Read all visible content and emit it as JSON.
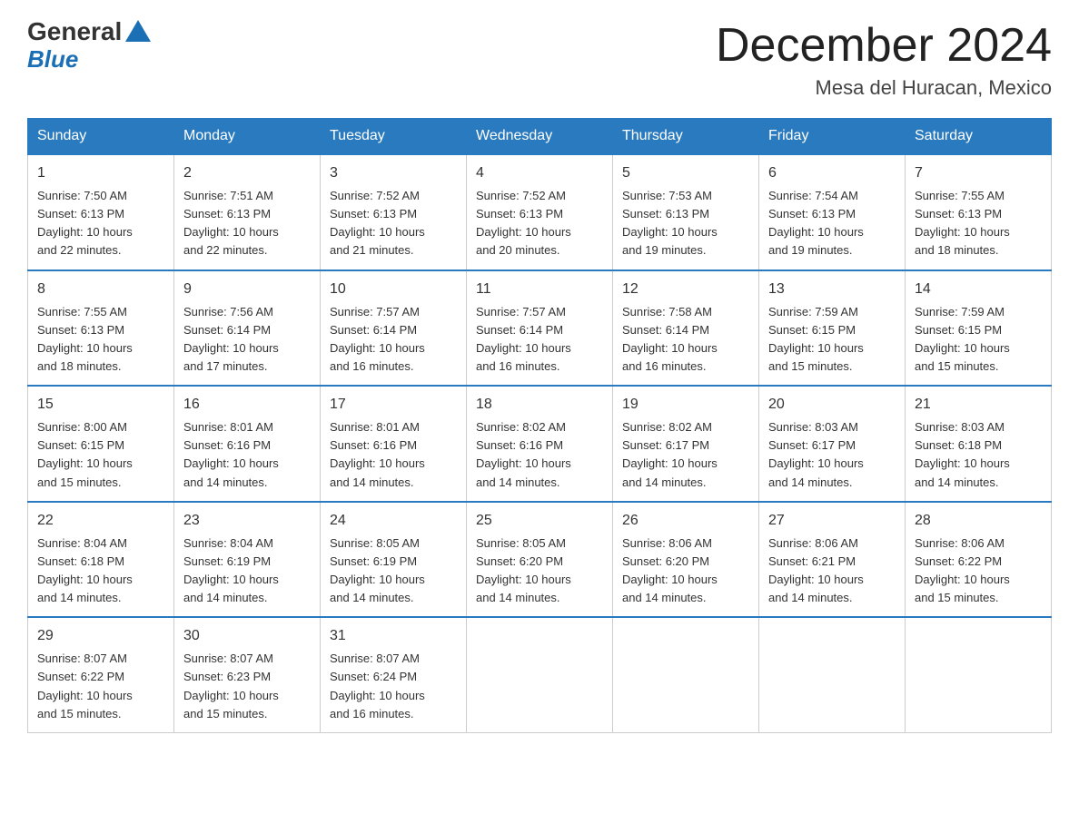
{
  "header": {
    "logo_general": "General",
    "logo_blue": "Blue",
    "title": "December 2024",
    "subtitle": "Mesa del Huracan, Mexico"
  },
  "days_of_week": [
    "Sunday",
    "Monday",
    "Tuesday",
    "Wednesday",
    "Thursday",
    "Friday",
    "Saturday"
  ],
  "weeks": [
    [
      {
        "day": "1",
        "sunrise": "7:50 AM",
        "sunset": "6:13 PM",
        "daylight": "10 hours and 22 minutes."
      },
      {
        "day": "2",
        "sunrise": "7:51 AM",
        "sunset": "6:13 PM",
        "daylight": "10 hours and 22 minutes."
      },
      {
        "day": "3",
        "sunrise": "7:52 AM",
        "sunset": "6:13 PM",
        "daylight": "10 hours and 21 minutes."
      },
      {
        "day": "4",
        "sunrise": "7:52 AM",
        "sunset": "6:13 PM",
        "daylight": "10 hours and 20 minutes."
      },
      {
        "day": "5",
        "sunrise": "7:53 AM",
        "sunset": "6:13 PM",
        "daylight": "10 hours and 19 minutes."
      },
      {
        "day": "6",
        "sunrise": "7:54 AM",
        "sunset": "6:13 PM",
        "daylight": "10 hours and 19 minutes."
      },
      {
        "day": "7",
        "sunrise": "7:55 AM",
        "sunset": "6:13 PM",
        "daylight": "10 hours and 18 minutes."
      }
    ],
    [
      {
        "day": "8",
        "sunrise": "7:55 AM",
        "sunset": "6:13 PM",
        "daylight": "10 hours and 18 minutes."
      },
      {
        "day": "9",
        "sunrise": "7:56 AM",
        "sunset": "6:14 PM",
        "daylight": "10 hours and 17 minutes."
      },
      {
        "day": "10",
        "sunrise": "7:57 AM",
        "sunset": "6:14 PM",
        "daylight": "10 hours and 16 minutes."
      },
      {
        "day": "11",
        "sunrise": "7:57 AM",
        "sunset": "6:14 PM",
        "daylight": "10 hours and 16 minutes."
      },
      {
        "day": "12",
        "sunrise": "7:58 AM",
        "sunset": "6:14 PM",
        "daylight": "10 hours and 16 minutes."
      },
      {
        "day": "13",
        "sunrise": "7:59 AM",
        "sunset": "6:15 PM",
        "daylight": "10 hours and 15 minutes."
      },
      {
        "day": "14",
        "sunrise": "7:59 AM",
        "sunset": "6:15 PM",
        "daylight": "10 hours and 15 minutes."
      }
    ],
    [
      {
        "day": "15",
        "sunrise": "8:00 AM",
        "sunset": "6:15 PM",
        "daylight": "10 hours and 15 minutes."
      },
      {
        "day": "16",
        "sunrise": "8:01 AM",
        "sunset": "6:16 PM",
        "daylight": "10 hours and 14 minutes."
      },
      {
        "day": "17",
        "sunrise": "8:01 AM",
        "sunset": "6:16 PM",
        "daylight": "10 hours and 14 minutes."
      },
      {
        "day": "18",
        "sunrise": "8:02 AM",
        "sunset": "6:16 PM",
        "daylight": "10 hours and 14 minutes."
      },
      {
        "day": "19",
        "sunrise": "8:02 AM",
        "sunset": "6:17 PM",
        "daylight": "10 hours and 14 minutes."
      },
      {
        "day": "20",
        "sunrise": "8:03 AM",
        "sunset": "6:17 PM",
        "daylight": "10 hours and 14 minutes."
      },
      {
        "day": "21",
        "sunrise": "8:03 AM",
        "sunset": "6:18 PM",
        "daylight": "10 hours and 14 minutes."
      }
    ],
    [
      {
        "day": "22",
        "sunrise": "8:04 AM",
        "sunset": "6:18 PM",
        "daylight": "10 hours and 14 minutes."
      },
      {
        "day": "23",
        "sunrise": "8:04 AM",
        "sunset": "6:19 PM",
        "daylight": "10 hours and 14 minutes."
      },
      {
        "day": "24",
        "sunrise": "8:05 AM",
        "sunset": "6:19 PM",
        "daylight": "10 hours and 14 minutes."
      },
      {
        "day": "25",
        "sunrise": "8:05 AM",
        "sunset": "6:20 PM",
        "daylight": "10 hours and 14 minutes."
      },
      {
        "day": "26",
        "sunrise": "8:06 AM",
        "sunset": "6:20 PM",
        "daylight": "10 hours and 14 minutes."
      },
      {
        "day": "27",
        "sunrise": "8:06 AM",
        "sunset": "6:21 PM",
        "daylight": "10 hours and 14 minutes."
      },
      {
        "day": "28",
        "sunrise": "8:06 AM",
        "sunset": "6:22 PM",
        "daylight": "10 hours and 15 minutes."
      }
    ],
    [
      {
        "day": "29",
        "sunrise": "8:07 AM",
        "sunset": "6:22 PM",
        "daylight": "10 hours and 15 minutes."
      },
      {
        "day": "30",
        "sunrise": "8:07 AM",
        "sunset": "6:23 PM",
        "daylight": "10 hours and 15 minutes."
      },
      {
        "day": "31",
        "sunrise": "8:07 AM",
        "sunset": "6:24 PM",
        "daylight": "10 hours and 16 minutes."
      },
      null,
      null,
      null,
      null
    ]
  ],
  "labels": {
    "sunrise": "Sunrise:",
    "sunset": "Sunset:",
    "daylight": "Daylight:"
  },
  "colors": {
    "header_bg": "#2a7abf",
    "header_border": "#2a7abf",
    "row_border_top": "#2a7abf"
  }
}
